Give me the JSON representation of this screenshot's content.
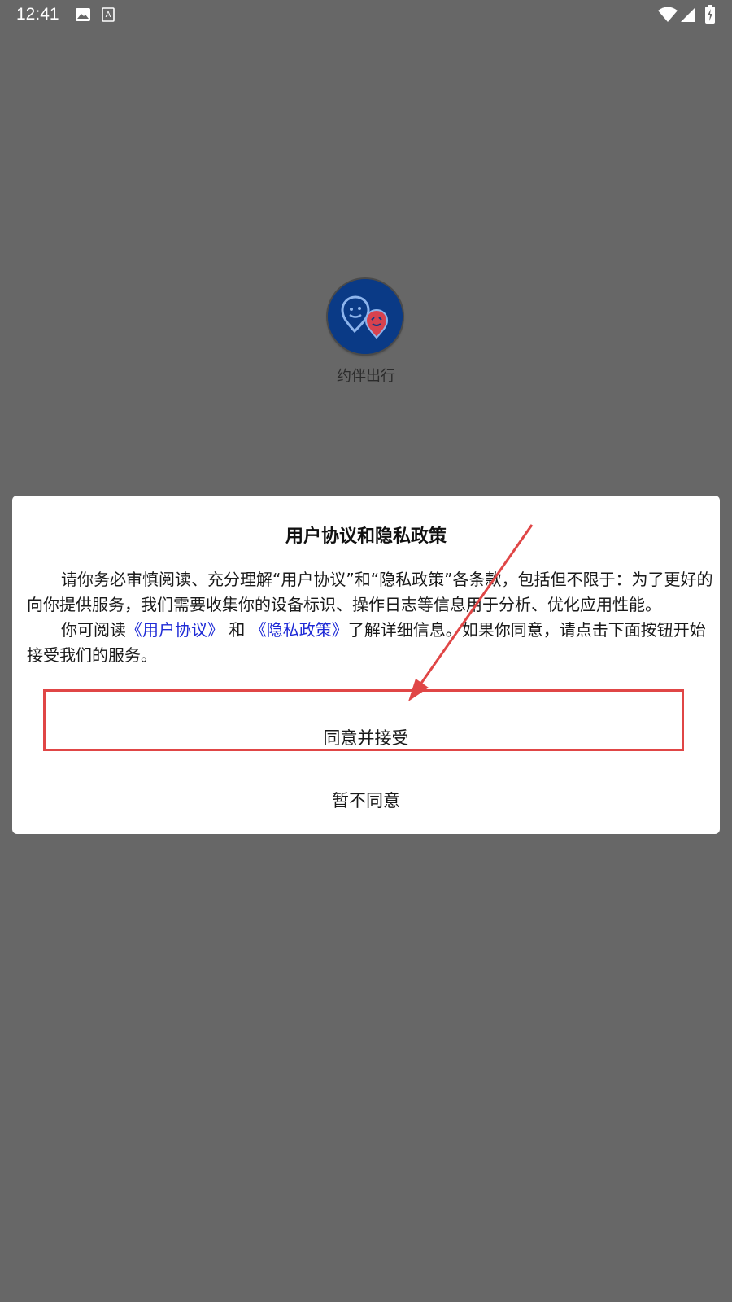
{
  "status_bar": {
    "time": "12:41",
    "icons": [
      "image-icon",
      "a11y-text-icon",
      "wifi-icon",
      "signal-icon",
      "battery-charging-icon"
    ]
  },
  "splash": {
    "app_name": "约伴出行",
    "logo_icon": "two-face-pins-logo-icon"
  },
  "dialog": {
    "title": "用户协议和隐私政策",
    "para1": "请你务必审慎阅读、充分理解“用户协议”和“隐私政策”各条款，包括但不限于：为了更好的向你提供服务，我们需要收集你的设备标识、操作日志等信息用于分析、优化应用性能。",
    "para2_prefix": "你可阅读",
    "link_user_agreement": "《用户协议》",
    "para2_and": " 和 ",
    "link_privacy_policy": "《隐私政策》",
    "para2_suffix": "了解详细信息。如果你同意，请点击下面按钮开始接受我们的服务。",
    "accept_label": "同意并接受",
    "decline_label": "暂不同意"
  },
  "colors": {
    "overlay": "#676767",
    "link": "#1f2bd6",
    "annotation": "#e04646",
    "logo_bg": "#0a3a86"
  }
}
